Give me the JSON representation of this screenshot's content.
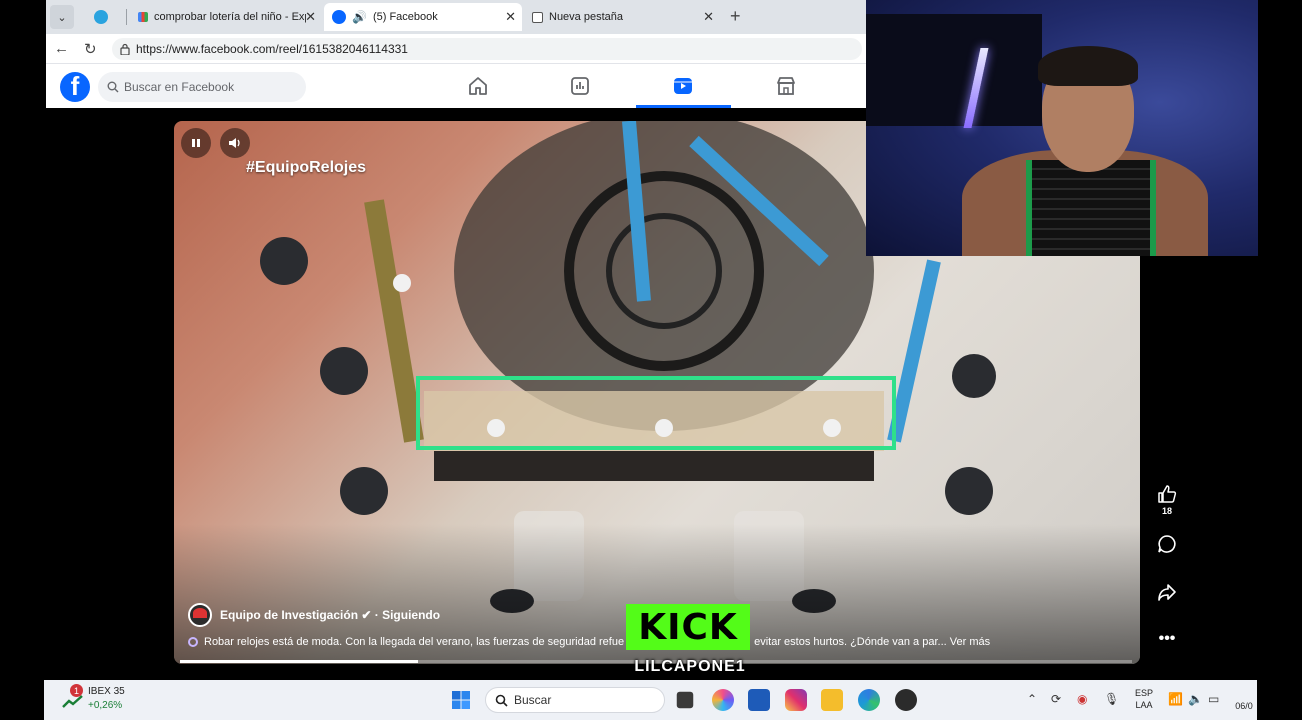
{
  "browser": {
    "tabs": [
      {
        "label": "",
        "icon": "telegram-icon"
      },
      {
        "label": "comprobar lotería del niño - Explo",
        "icon": "search-favicon"
      },
      {
        "label": "(5) Facebook",
        "icon": "facebook-icon",
        "active": true
      },
      {
        "label": "Nueva pestaña",
        "icon": "newtab-icon"
      }
    ],
    "url": "https://www.facebook.com/reel/1615382046114331"
  },
  "facebook": {
    "search_placeholder": "Buscar en Facebook",
    "nav": [
      "home-icon",
      "dashboard-icon",
      "reels-icon",
      "marketplace-icon"
    ]
  },
  "reel": {
    "hashtag": "#EquipoRelojes",
    "author": "Equipo de Investigación ✔ · Siguiendo",
    "caption": "Robar relojes está de moda. Con la llegada del verano, las fuerzas de seguridad refue",
    "caption_tail": "evitar estos hurtos. ¿Dónde van a par... Ver más",
    "like_count": "18",
    "progress": 0.25,
    "highlight_color": "#2fe08a"
  },
  "kick": {
    "logo": "KICK",
    "username": "LILCAPONE1",
    "color": "#53fc18"
  },
  "taskbar": {
    "stock_badge": "1",
    "stock_name": "IBEX 35",
    "stock_change": "+0,26%",
    "search_label": "Buscar",
    "lang1": "ESP",
    "lang2": "LAA",
    "clock": "06/0"
  }
}
